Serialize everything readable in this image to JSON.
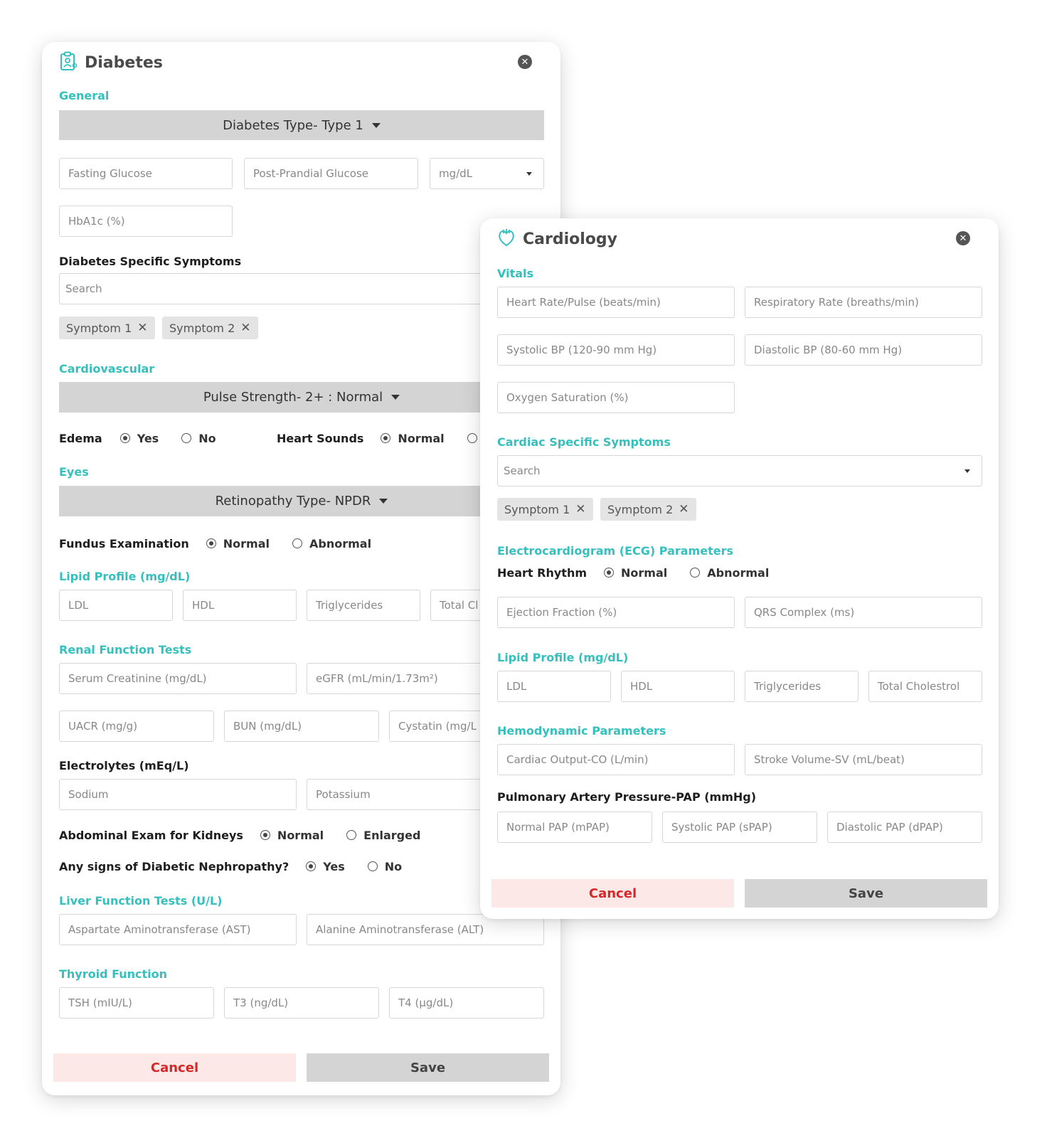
{
  "diabetes": {
    "icon": "clipboard-doctor-icon",
    "title": "Diabetes",
    "close_icon": "close-icon",
    "general": {
      "heading": "General",
      "type_dropdown": "Diabetes Type- Type 1",
      "fasting_glucose": "Fasting Glucose",
      "post_prandial_glucose": "Post-Prandial Glucose",
      "unit_select": "mg/dL",
      "hba1c": "HbA1c (%)"
    },
    "symptoms": {
      "heading": "Diabetes Specific Symptoms",
      "search_placeholder": "Search",
      "chips": [
        "Symptom 1",
        "Symptom 2"
      ]
    },
    "cardiovascular": {
      "heading": "Cardiovascular",
      "pulse_dropdown": "Pulse Strength- 2+ : Normal",
      "edema_label": "Edema",
      "edema_options": [
        "Yes",
        "No"
      ],
      "edema_selected": "Yes",
      "heart_sounds_label": "Heart Sounds",
      "heart_sounds_options": [
        "Normal"
      ],
      "heart_sounds_selected": "Normal"
    },
    "eyes": {
      "heading": "Eyes",
      "retinopathy_dropdown": "Retinopathy Type- NPDR",
      "fundus_label": "Fundus Examination",
      "fundus_options": [
        "Normal",
        "Abnormal"
      ],
      "fundus_selected": "Normal"
    },
    "lipid": {
      "heading": "Lipid Profile (mg/dL)",
      "fields": [
        "LDL",
        "HDL",
        "Triglycerides",
        "Total Cl"
      ]
    },
    "renal": {
      "heading": "Renal Function Tests",
      "fields_row1": [
        "Serum Creatinine (mg/dL)",
        "eGFR (mL/min/1.73m²)"
      ],
      "fields_row2": [
        "UACR (mg/g)",
        "BUN (mg/dL)",
        "Cystatin (mg/L"
      ]
    },
    "electrolytes": {
      "heading": "Electrolytes (mEq/L)",
      "fields": [
        "Sodium",
        "Potassium"
      ]
    },
    "kidney_exam": {
      "label": "Abdominal Exam for Kidneys",
      "options": [
        "Normal",
        "Enlarged"
      ],
      "selected": "Normal"
    },
    "nephropathy": {
      "label": "Any signs of Diabetic Nephropathy?",
      "options": [
        "Yes",
        "No"
      ],
      "selected": "Yes"
    },
    "liver": {
      "heading": "Liver Function Tests (U/L)",
      "fields": [
        "Aspartate Aminotransferase (AST)",
        "Alanine Aminotransferase (ALT)"
      ]
    },
    "thyroid": {
      "heading": "Thyroid Function",
      "fields": [
        "TSH (mIU/L)",
        "T3 (ng/dL)",
        "T4 (µg/dL)"
      ]
    },
    "cancel_label": "Cancel",
    "save_label": "Save"
  },
  "cardiology": {
    "icon": "heart-icon",
    "title": "Cardiology",
    "close_icon": "close-icon",
    "vitals": {
      "heading": "Vitals",
      "fields": [
        "Heart Rate/Pulse (beats/min)",
        "Respiratory Rate (breaths/min)",
        "Systolic BP (120-90 mm Hg)",
        "Diastolic BP (80-60 mm Hg)",
        "Oxygen Saturation (%)"
      ]
    },
    "symptoms": {
      "heading": "Cardiac Specific Symptoms",
      "search_placeholder": "Search",
      "chips": [
        "Symptom 1",
        "Symptom 2"
      ]
    },
    "ecg": {
      "heading": "Electrocardiogram (ECG) Parameters",
      "rhythm_label": "Heart Rhythm",
      "rhythm_options": [
        "Normal",
        "Abnormal"
      ],
      "rhythm_selected": "Normal",
      "fields": [
        "Ejection Fraction (%)",
        "QRS Complex (ms)"
      ]
    },
    "lipid": {
      "heading": "Lipid Profile (mg/dL)",
      "fields": [
        "LDL",
        "HDL",
        "Triglycerides",
        "Total Cholestrol"
      ]
    },
    "hemodynamic": {
      "heading": "Hemodynamic Parameters",
      "fields": [
        "Cardiac Output-CO (L/min)",
        "Stroke Volume-SV (mL/beat)"
      ]
    },
    "pap": {
      "heading": "Pulmonary Artery Pressure-PAP (mmHg)",
      "fields": [
        "Normal PAP (mPAP)",
        "Systolic PAP (sPAP)",
        "Diastolic PAP (dPAP)"
      ]
    },
    "cancel_label": "Cancel",
    "save_label": "Save"
  },
  "colors": {
    "accent": "#35c0bd",
    "cancel_text": "#d62828",
    "cancel_bg": "#fde8e8",
    "save_bg": "#d4d4d4"
  }
}
